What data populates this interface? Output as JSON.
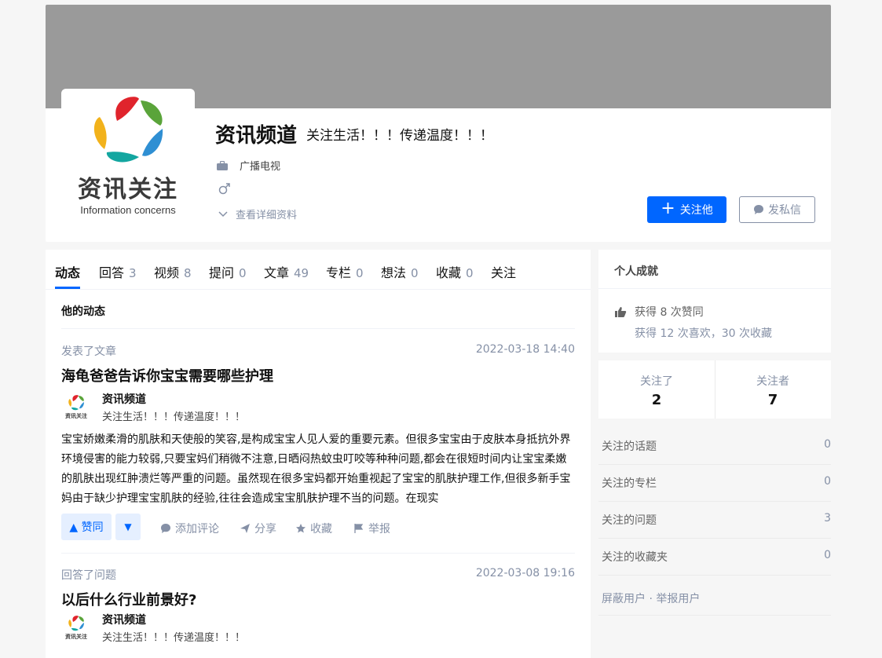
{
  "profile": {
    "name": "资讯频道",
    "headline": "关注生活！！！传递温度！！！",
    "industry": "广播电视",
    "gender_icon": "male-icon",
    "detail_link": "查看详细资料",
    "logo_text_cn": "资讯关注",
    "logo_text_en": "Information concerns",
    "follow_label": "关注他",
    "message_label": "发私信"
  },
  "tabs": [
    {
      "label": "动态",
      "count": ""
    },
    {
      "label": "回答",
      "count": "3"
    },
    {
      "label": "视频",
      "count": "8"
    },
    {
      "label": "提问",
      "count": "0"
    },
    {
      "label": "文章",
      "count": "49"
    },
    {
      "label": "专栏",
      "count": "0"
    },
    {
      "label": "想法",
      "count": "0"
    },
    {
      "label": "收藏",
      "count": "0"
    },
    {
      "label": "关注",
      "count": ""
    }
  ],
  "feed": {
    "section_title": "他的动态",
    "items": [
      {
        "meta": "发表了文章",
        "time": "2022-03-18 14:40",
        "title": "海龟爸爸告诉你宝宝需要哪些护理",
        "author": "资讯频道",
        "author_headline": "关注生活！！！传递温度！！！",
        "excerpt": "宝宝娇嫩柔滑的肌肤和天使般的笑容,是构成宝宝人见人爱的重要元素。但很多宝宝由于皮肤本身抵抗外界环境侵害的能力较弱,只要宝妈们稍微不注意,日晒闷热蚊虫叮咬等种种问题,都会在很短时间内让宝宝柔嫩的肌肤出现红肿溃烂等严重的问题。虽然现在很多宝妈都开始重视起了宝宝的肌肤护理工作,但很多新手宝妈由于缺少护理宝宝肌肤的经验,往往会造成宝宝肌肤护理不当的问题。在现实"
      },
      {
        "meta": "回答了问题",
        "time": "2022-03-08 19:16",
        "title": "以后什么行业前景好?",
        "author": "资讯频道",
        "author_headline": "关注生活！！！传递温度！！！"
      }
    ],
    "actions": {
      "upvote": "▲ 赞同",
      "downvote": "▼",
      "comment": "添加评论",
      "share": "分享",
      "collect": "收藏",
      "report": "举报"
    }
  },
  "sidebar": {
    "achievements": {
      "title": "个人成就",
      "likes": "获得 8 次赞同",
      "stats": "获得 12 次喜欢，30 次收藏"
    },
    "following": {
      "label": "关注了",
      "count": "2"
    },
    "followers": {
      "label": "关注者",
      "count": "7"
    },
    "lists": [
      {
        "label": "关注的话题",
        "value": "0"
      },
      {
        "label": "关注的专栏",
        "value": "0"
      },
      {
        "label": "关注的问题",
        "value": "3"
      },
      {
        "label": "关注的收藏夹",
        "value": "0"
      }
    ],
    "block_report": "屏蔽用户 · 举报用户"
  },
  "colors": {
    "accent": "#0066ff",
    "muted": "#8590a6",
    "cover": "#9a9a9a"
  }
}
